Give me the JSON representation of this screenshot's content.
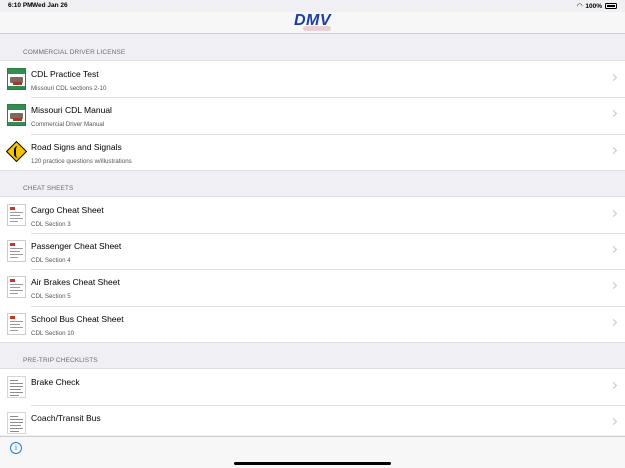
{
  "status_bar": {
    "time": "6:10 PM",
    "date": "Wed Jan 26",
    "battery": "100%"
  },
  "nav": {
    "logo_text": "DMV",
    "logo_color": "#1a3f9c"
  },
  "sections": [
    {
      "header": "COMMERCIAL DRIVER LICENSE",
      "items": [
        {
          "title": "CDL Practice Test",
          "subtitle": "Missouri CDL sections 2-10",
          "icon": "cdl-book-icon"
        },
        {
          "title": "Missouri CDL Manual",
          "subtitle": "Commercial Driver Manual",
          "icon": "cdl-book-icon"
        },
        {
          "title": "Road Signs and Signals",
          "subtitle": "120 practice questions w/illustrations",
          "icon": "winding-road-sign-icon"
        }
      ]
    },
    {
      "header": "CHEAT SHEETS",
      "items": [
        {
          "title": "Cargo Cheat Sheet",
          "subtitle": "CDL Section 3",
          "icon": "cheat-sheet-icon"
        },
        {
          "title": "Passenger Cheat Sheet",
          "subtitle": "CDL Section 4",
          "icon": "cheat-sheet-icon"
        },
        {
          "title": "Air Brakes Cheat Sheet",
          "subtitle": "CDL Section 5",
          "icon": "cheat-sheet-icon"
        },
        {
          "title": "School Bus Cheat Sheet",
          "subtitle": "CDL Section 10",
          "icon": "cheat-sheet-icon"
        }
      ]
    },
    {
      "header": "PRE-TRIP CHECKLISTS",
      "items": [
        {
          "title": "Brake Check",
          "subtitle": "",
          "icon": "checklist-document-icon"
        },
        {
          "title": "Coach/Transit Bus",
          "subtitle": "",
          "icon": "checklist-document-icon"
        }
      ]
    }
  ],
  "bottom_bar": {
    "info_glyph": "i"
  }
}
